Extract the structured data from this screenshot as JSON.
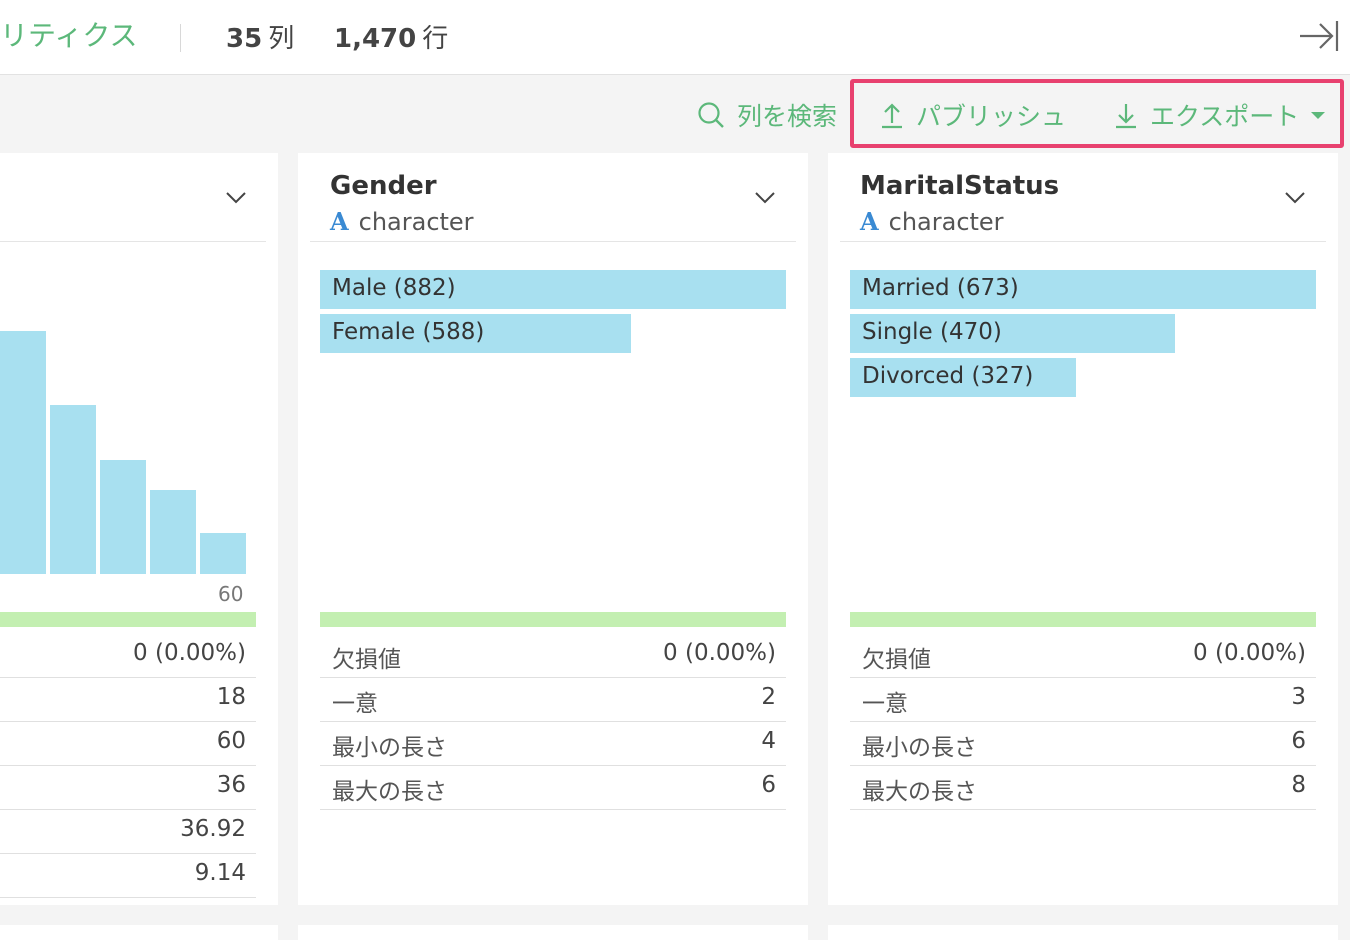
{
  "header": {
    "tab_label": "リティクス",
    "columns_count": "35",
    "columns_unit": "列",
    "rows_count": "1,470",
    "rows_unit": "行"
  },
  "toolbar": {
    "search_label": "列を検索",
    "publish_label": "パブリッシュ",
    "export_label": "エクスポート"
  },
  "colors": {
    "accent": "#5cb87a",
    "highlight": "#e8416f",
    "bar": "#a8e0f0",
    "valid_bar": "#c3efb1",
    "type_icon": "#3a8ad3"
  },
  "icons": [
    "collapse-panel-icon",
    "search-icon",
    "upload-icon",
    "download-icon",
    "caret-down-icon",
    "chevron-down-icon",
    "character-type-icon"
  ],
  "cards": {
    "left": {
      "axis_tick": "60",
      "histogram_relative_heights": [
        1.0,
        0.694,
        0.471,
        0.347,
        0.169
      ],
      "stats": [
        {
          "value": "0 (0.00%)"
        },
        {
          "value": "18"
        },
        {
          "value": "60"
        },
        {
          "value": "36"
        },
        {
          "value": "36.92"
        },
        {
          "value": "9.14"
        }
      ]
    },
    "gender": {
      "name": "Gender",
      "type_icon": "A",
      "type": "character",
      "bars": [
        {
          "label": "Male (882)",
          "count": 882
        },
        {
          "label": "Female (588)",
          "count": 588
        }
      ],
      "stats": [
        {
          "label": "欠損値",
          "value": "0 (0.00%)"
        },
        {
          "label": "一意",
          "value": "2"
        },
        {
          "label": "最小の長さ",
          "value": "4"
        },
        {
          "label": "最大の長さ",
          "value": "6"
        }
      ]
    },
    "marital": {
      "name": "MaritalStatus",
      "type_icon": "A",
      "type": "character",
      "bars": [
        {
          "label": "Married (673)",
          "count": 673
        },
        {
          "label": "Single (470)",
          "count": 470
        },
        {
          "label": "Divorced (327)",
          "count": 327
        }
      ],
      "stats": [
        {
          "label": "欠損値",
          "value": "0 (0.00%)"
        },
        {
          "label": "一意",
          "value": "3"
        },
        {
          "label": "最小の長さ",
          "value": "6"
        },
        {
          "label": "最大の長さ",
          "value": "8"
        }
      ]
    }
  }
}
